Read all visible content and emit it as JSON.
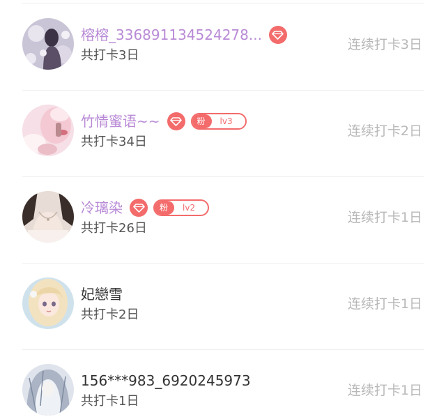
{
  "checkin_list": {
    "items": [
      {
        "name": "榕榕_336891134524278...",
        "vip": true,
        "fan_badge": null,
        "total_checkin": "共打卡3日",
        "streak": "连续打卡3日",
        "avatar": "avatar-girl-dark-flowers"
      },
      {
        "name": "竹情蜜语~~",
        "vip": true,
        "fan_badge": {
          "label": "粉",
          "level": "lv3"
        },
        "total_checkin": "共打卡34日",
        "streak": "连续打卡2日",
        "avatar": "avatar-girl-pink"
      },
      {
        "name": "冷璃染",
        "vip": true,
        "fan_badge": {
          "label": "粉",
          "level": "lv2"
        },
        "total_checkin": "共打卡26日",
        "streak": "连续打卡1日",
        "avatar": "avatar-necklace"
      },
      {
        "name": "妃戀雪",
        "vip": false,
        "fan_badge": null,
        "total_checkin": "共打卡2日",
        "streak": "连续打卡1日",
        "avatar": "avatar-anime-blonde"
      },
      {
        "name": "156***983_6920245973",
        "vip": false,
        "fan_badge": null,
        "total_checkin": "共打卡1日",
        "streak": "连续打卡1日",
        "avatar": "avatar-silver-hair"
      }
    ]
  },
  "colors": {
    "vip_name": "#b98ad6",
    "badge_red": "#f36b6b",
    "streak_text": "#b8b8b8",
    "name_text": "#333333",
    "subtext": "#555555"
  },
  "icons": {
    "vip": "diamond-icon",
    "fan": "fan-badge"
  }
}
